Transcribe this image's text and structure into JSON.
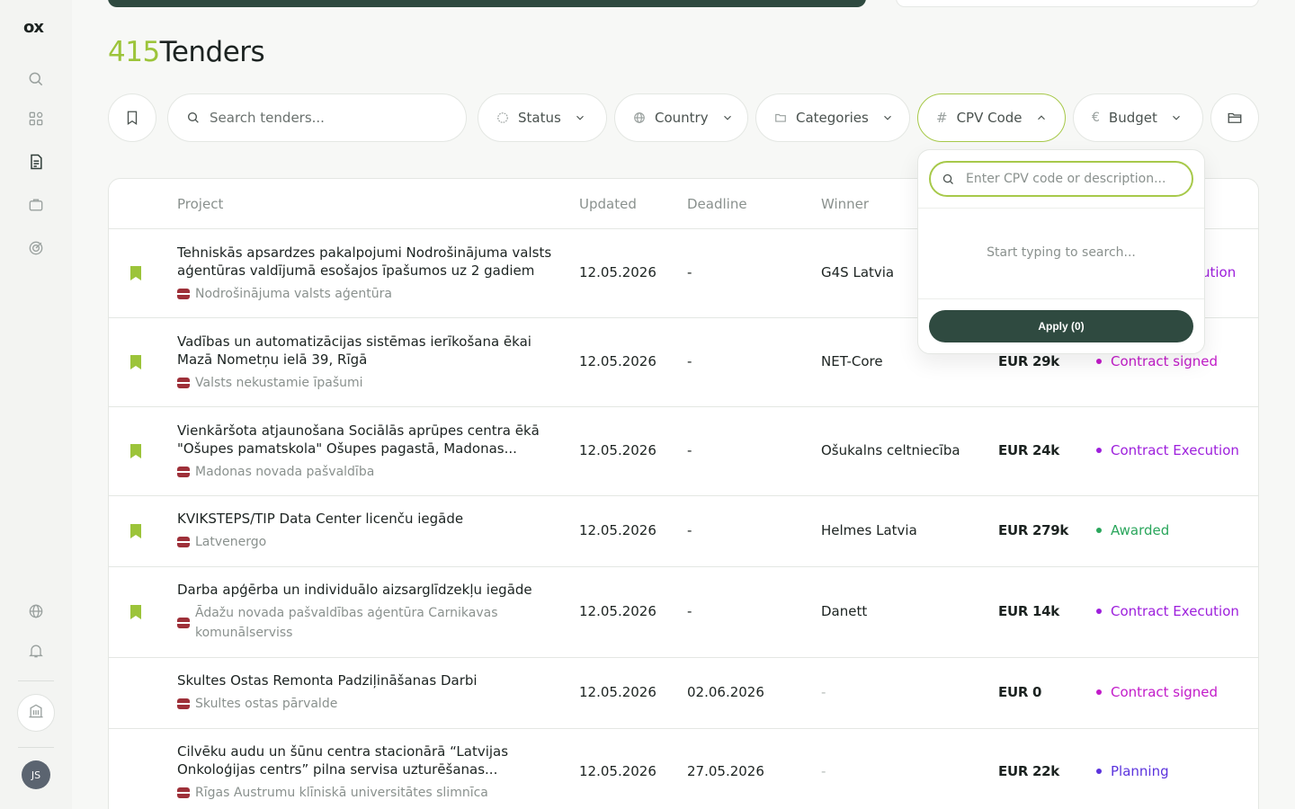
{
  "sidebar": {
    "logo": "ox",
    "avatar_initials": "JS"
  },
  "header": {
    "count": "415",
    "title": "Tenders"
  },
  "filters": {
    "search_placeholder": "Search tenders...",
    "status": "Status",
    "country": "Country",
    "categories": "Categories",
    "cpv_code": "CPV Code",
    "budget": "Budget"
  },
  "cpv_dropdown": {
    "placeholder": "Enter CPV code or description...",
    "empty_text": "Start typing to search...",
    "apply_label": "Apply (0)"
  },
  "table": {
    "columns": [
      "Project",
      "Updated",
      "Deadline",
      "Winner"
    ],
    "rows": [
      {
        "title": "Tehniskās apsardzes pakalpojumi Nodrošinājuma valsts aģentūras valdījumā esošajos īpašumos uz 2 gadiem",
        "buyer": "Nodrošinājuma valsts aģentūra",
        "updated": "12.05.2026",
        "deadline": "-",
        "winner": "G4S Latvia",
        "budget": "",
        "status": "ution",
        "bookmarked": true
      },
      {
        "title": "Vadības un automatizācijas sistēmas ierīkošana ēkai Mazā Nometņu ielā 39, Rīgā",
        "buyer": "Valsts nekustamie īpašumi",
        "updated": "12.05.2026",
        "deadline": "-",
        "winner": "NET-Core",
        "budget": "EUR 29k",
        "status": "Contract signed",
        "bookmarked": true
      },
      {
        "title": "Vienkāršota atjaunošana Sociālās aprūpes centra ēkā \"Ošupes pamatskola\" Ošupes pagastā, Madonas...",
        "buyer": "Madonas novada pašvaldība",
        "updated": "12.05.2026",
        "deadline": "-",
        "winner": "Ošukalns celtniecība",
        "budget": "EUR 24k",
        "status": "Contract Execution",
        "bookmarked": true
      },
      {
        "title": "KVIKSTEPS/TIP Data Center licenču iegāde",
        "buyer": "Latvenergo",
        "updated": "12.05.2026",
        "deadline": "-",
        "winner": "Helmes Latvia",
        "budget": "EUR 279k",
        "status": "Awarded",
        "bookmarked": true
      },
      {
        "title": "Darba apģērba un individuālo aizsarglīdzekļu iegāde",
        "buyer": "Ādažu novada pašvaldības aģentūra Carnikavas komunālserviss",
        "updated": "12.05.2026",
        "deadline": "-",
        "winner": "Danett",
        "budget": "EUR 14k",
        "status": "Contract Execution",
        "bookmarked": true
      },
      {
        "title": "Skultes Ostas Remonta Padziļināšanas Darbi",
        "buyer": "Skultes ostas pārvalde",
        "updated": "12.05.2026",
        "deadline": "02.06.2026",
        "winner": "-",
        "budget": "EUR 0",
        "status": "Contract signed",
        "bookmarked": false
      },
      {
        "title": "Cilvēku audu un šūnu centra stacionārā “Latvijas Onkoloģijas centrs” pilna servisa uzturēšanas...",
        "buyer": "Rīgas Austrumu klīniskā universitātes slimnīca",
        "updated": "12.05.2026",
        "deadline": "27.05.2026",
        "winner": "-",
        "budget": "EUR 22k",
        "status": "Planning",
        "bookmarked": false
      }
    ]
  },
  "colors": {
    "accent_green": "#9cc43a",
    "dark_green": "#2f4a40",
    "status_signed": "#c21bc9",
    "status_execution": "#9d1fdc",
    "status_awarded": "#2aa65c",
    "status_planning": "#5b33dd",
    "flag_red": "#9e3039"
  }
}
